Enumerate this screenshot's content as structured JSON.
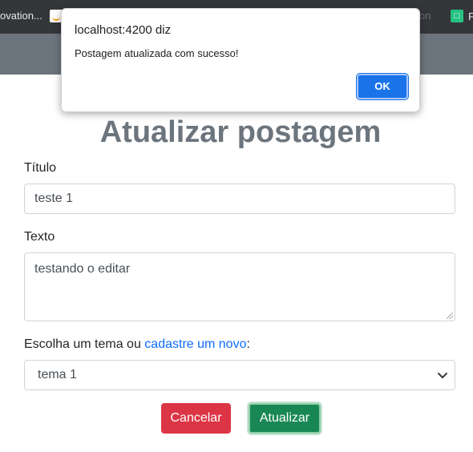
{
  "bookmarks": {
    "item_1": "ovation...",
    "item_2": "on",
    "item_3": "F"
  },
  "dialog": {
    "title": "localhost:4200 diz",
    "message": "Postagem atualizada com sucesso!",
    "ok_label": "OK"
  },
  "page": {
    "title": "Atualizar postagem"
  },
  "form": {
    "title_label": "Título",
    "title_value": "teste 1",
    "text_label": "Texto",
    "text_value": "testando o editar",
    "theme_label_prefix": "Escolha um tema ou ",
    "theme_link": "cadastre um novo",
    "theme_label_suffix": ":",
    "theme_selected": "tema 1",
    "cancel_label": "Cancelar",
    "update_label": "Atualizar"
  },
  "colors": {
    "navbar": "#6c757d",
    "cancel": "#dc3545",
    "update": "#198754",
    "link": "#0d6efd",
    "dialog_button": "#1a73e8"
  }
}
